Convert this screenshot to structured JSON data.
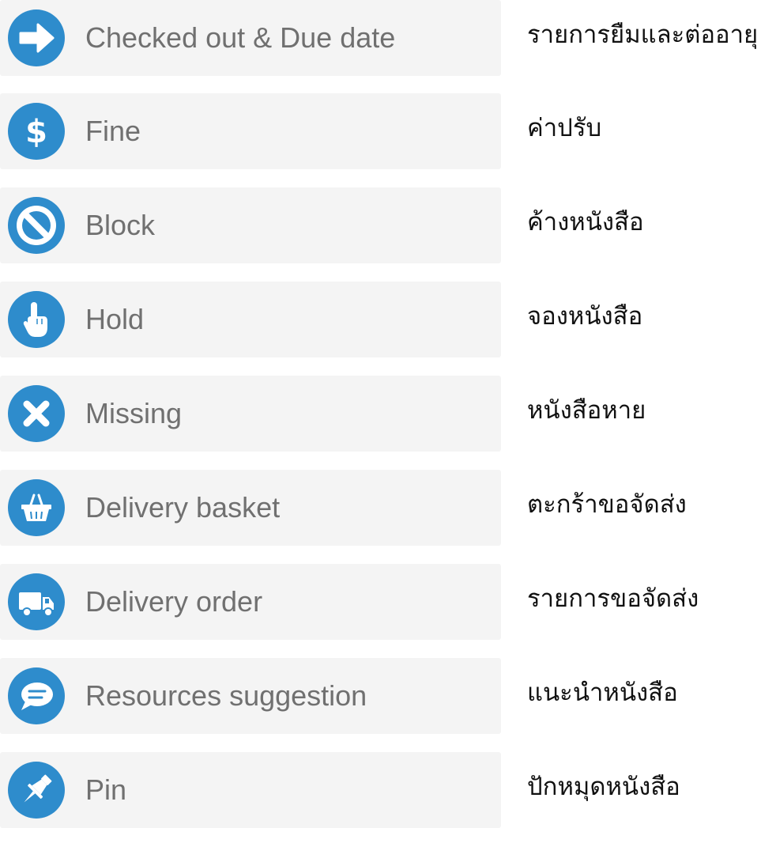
{
  "accent_color": "#2e8ccc",
  "items": [
    {
      "icon": "arrow-right-icon",
      "label": "Checked out & Due date",
      "thai": "รายการยืมและต่ออายุ"
    },
    {
      "icon": "dollar-icon",
      "label": "Fine",
      "thai": "ค่าปรับ"
    },
    {
      "icon": "block-icon",
      "label": "Block",
      "thai": "ค้างหนังสือ"
    },
    {
      "icon": "hand-pointer-icon",
      "label": "Hold",
      "thai": "จองหนังสือ"
    },
    {
      "icon": "close-icon",
      "label": "Missing",
      "thai": "หนังสือหาย"
    },
    {
      "icon": "basket-icon",
      "label": "Delivery basket",
      "thai": "ตะกร้าขอจัดส่ง"
    },
    {
      "icon": "truck-icon",
      "label": "Delivery order",
      "thai": "รายการขอจัดส่ง"
    },
    {
      "icon": "chat-bubble-icon",
      "label": "Resources suggestion",
      "thai": "แนะนำหนังสือ"
    },
    {
      "icon": "pin-icon",
      "label": "Pin",
      "thai": "ปักหมุดหนังสือ"
    }
  ]
}
